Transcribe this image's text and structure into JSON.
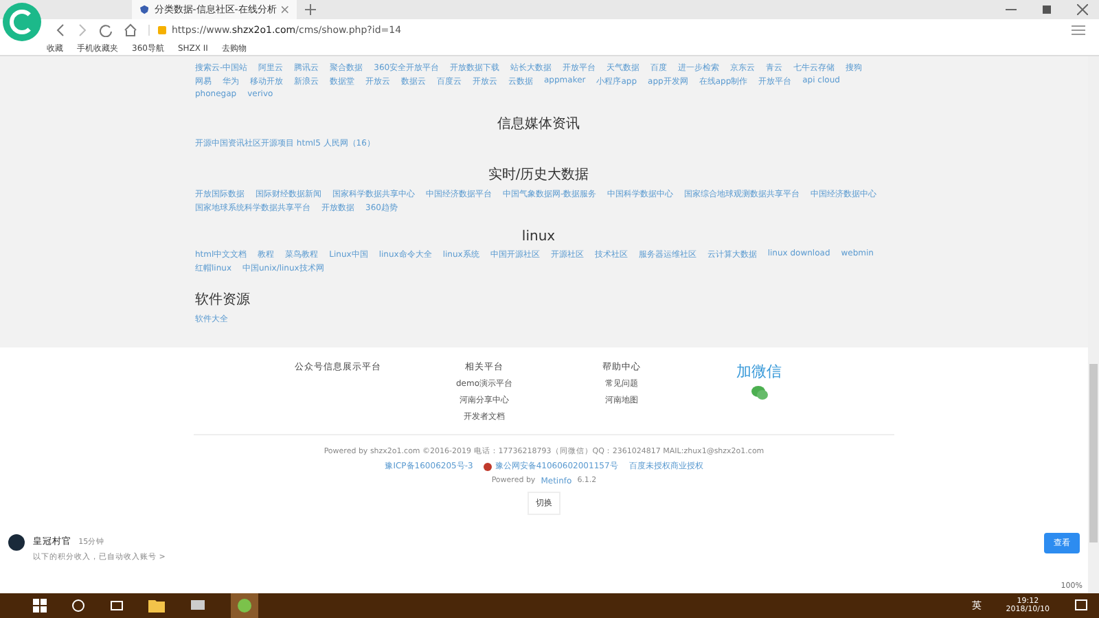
{
  "browser": {
    "tab_title": "分类数据-信息社区-在线分析",
    "url_prefix": "https://www.",
    "url_domain": "shzx2o1.com",
    "url_path": "/cms/show.php?id=14",
    "bookmarks": [
      "收藏",
      "手机收藏夹",
      "360导航",
      "SHZX II",
      "去购物"
    ],
    "zoom": "100%"
  },
  "sections": [
    {
      "links": [
        "搜索云-中国站",
        "阿里云",
        "腾讯云",
        "聚合数据",
        "360安全开放平台",
        "开放数据下载",
        "站长大数据",
        "开放平台",
        "天气数据",
        "百度",
        "进一步检索",
        "京东云",
        "青云",
        "七牛云存储",
        "搜狗",
        "网易",
        "华为",
        "移动开放",
        "新浪云",
        "数据堂",
        "开放云",
        "数据云",
        "百度云",
        "开放云",
        "云数据",
        "appmaker",
        "小程序app",
        "app开发网",
        "在线app制作",
        "开放平台",
        "api cloud",
        "phonegap",
        "verivo"
      ]
    },
    {
      "heading": "信息媒体资讯",
      "kind": "centered",
      "links": [
        "开源中国资讯社区开源项目 html5 人民网（16）"
      ]
    },
    {
      "heading": "实时/历史大数据",
      "kind": "centered",
      "links": [
        "开放国际数据",
        "国际财经数据新闻",
        "国家科学数据共享中心",
        "中国经济数据平台",
        "中国气象数据网-数据服务",
        "中国科学数据中心",
        "国家综合地球观测数据共享平台",
        "中国经济数据中心",
        "国家地球系统科学数据共享平台",
        "开放数据",
        "360趋势"
      ]
    },
    {
      "heading": "linux",
      "kind": "centered",
      "links": [
        "html中文文档",
        "教程",
        "菜鸟教程",
        "Linux中国",
        "linux命令大全",
        "linux系统",
        "中国开源社区",
        "开源社区",
        "技术社区",
        "服务器运维社区",
        "云计算大数据",
        "linux download",
        "webmin",
        "红帽linux",
        "中国unix/linux技术网"
      ]
    },
    {
      "heading": "软件资源",
      "kind": "plain",
      "links": [
        "软件大全"
      ]
    }
  ],
  "footer": {
    "columns": [
      {
        "title": "公众号信息展示平台"
      },
      {
        "title": "相关平台",
        "items": [
          "demo演示平台",
          "河南分享中心",
          "开发者文档"
        ]
      },
      {
        "title": "帮助中心",
        "items": [
          "常见问题",
          "河南地图"
        ]
      }
    ],
    "wechat_title": "加微信",
    "copyright": "Powered by shzx2o1.com ©2016-2019 电话：17736218793（同微信）QQ：2361024817 MAIL:zhux1@shzx2o1.com",
    "licenses": [
      "豫ICP备16006205号-3",
      "豫公网安备41060602001157号",
      "百度未授权商业授权"
    ],
    "powered": "Powered by",
    "powered_link": "Metinfo",
    "version": "6.1.2",
    "switch_button": "切换"
  },
  "notification": {
    "title": "皇冠村官",
    "time": "15分钟",
    "text": "以下的积分收入，已自动收入账号 >",
    "button": "查看"
  },
  "taskbar": {
    "time": "19:12",
    "date": "2018/10/10",
    "ime": "英"
  }
}
